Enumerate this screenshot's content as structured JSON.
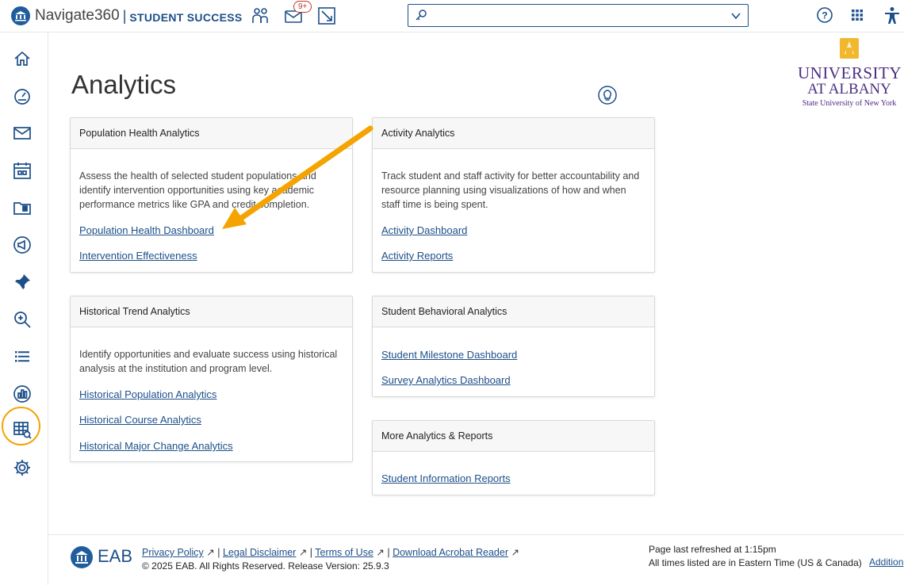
{
  "header": {
    "brand": "Navigate360",
    "separator": "|",
    "product": "STUDENT SUCCESS",
    "mail_badge": "9+",
    "search_placeholder": ""
  },
  "sidebar": {
    "items": [
      "home-icon",
      "dashboard-gauge-icon",
      "mail-icon",
      "calendar-icon",
      "folder-icon",
      "campaign-icon",
      "pin-icon",
      "search-zoom-icon",
      "list-icon",
      "analytics-icon",
      "report-search-icon",
      "settings-icon"
    ],
    "active": "analytics-icon"
  },
  "page": {
    "title": "Analytics"
  },
  "university_logo": {
    "line1": "UNIVERSITY",
    "line2": "AT ALBANY",
    "line3": "State University of New York"
  },
  "cards": {
    "population_health": {
      "title": "Population Health Analytics",
      "description": "Assess the health of selected student populations and identify intervention opportunities using key academic performance metrics like GPA and credit completion.",
      "links": [
        "Population Health Dashboard",
        "Intervention Effectiveness"
      ]
    },
    "activity": {
      "title": "Activity Analytics",
      "description": "Track student and staff activity for better accountability and resource planning using visualizations of how and when staff time is being spent.",
      "links": [
        "Activity Dashboard",
        "Activity Reports"
      ]
    },
    "historical_trend": {
      "title": "Historical Trend Analytics",
      "description": "Identify opportunities and evaluate success using historical analysis at the institution and program level.",
      "links": [
        "Historical Population Analytics",
        "Historical Course Analytics",
        "Historical Major Change Analytics"
      ]
    },
    "student_behavioral": {
      "title": "Student Behavioral Analytics",
      "links": [
        "Student Milestone Dashboard",
        "Survey Analytics Dashboard"
      ]
    },
    "more_reports": {
      "title": "More Analytics & Reports",
      "links": [
        "Student Information Reports"
      ]
    }
  },
  "footer": {
    "logo_text": "EAB",
    "links": [
      "Privacy Policy",
      "Legal Disclaimer",
      "Terms of Use",
      "Download Acrobat Reader"
    ],
    "link_separator": "|",
    "copyright": "© 2025 EAB. All Rights Reserved. Release Version: 25.9.3",
    "refresh_text": "Page last refreshed at 1:15pm",
    "timezone_text": "All times listed are in Eastern Time (US & Canada)",
    "additional_link": "Addition"
  },
  "colors": {
    "brand_blue": "#1d4f8a",
    "highlight_orange": "#f4a300",
    "ualbany_purple": "#4b2e83",
    "ualbany_gold": "#f1b82d"
  }
}
